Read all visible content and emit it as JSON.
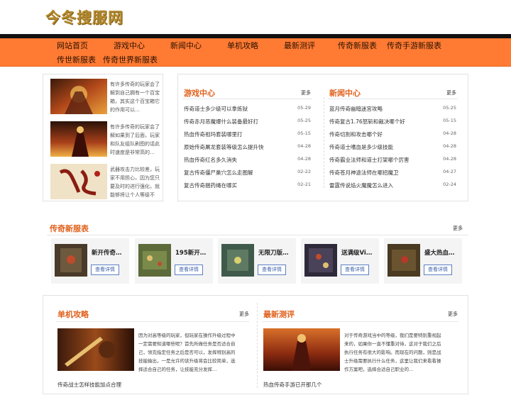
{
  "site": {
    "logo": "今冬搜服网"
  },
  "nav": {
    "items": [
      "网站首页",
      "游戏中心",
      "新闻中心",
      "单机攻略",
      "最新测评",
      "传奇新服表",
      "传奇手游新服表",
      "传世新服表",
      "传奇世界新服表"
    ]
  },
  "featured": [
    {
      "text": "有许多传奇的玩家会了解到自己拥有一个百宝箱，其实这个百宝箱它的作用可以…"
    },
    {
      "text": "有许多传奇的玩家会了解如果到了后面，玩家和队友组队刷图的话此时速度是非常高的…"
    },
    {
      "text": "武器攻击力比较差，玩家不用担心，因为您只要及时的进行强化，就能够将让个人等级不同…"
    }
  ],
  "game_center": {
    "title": "游戏中心",
    "more": "更多",
    "items": [
      {
        "title": "传奇道士多少级可以拿炼狱",
        "date": "05-29"
      },
      {
        "title": "传奇赤月恶魔爆什么装备最好打",
        "date": "05-25"
      },
      {
        "title": "热血传奇祖玛套装哪里打",
        "date": "05-15"
      },
      {
        "title": "原始传奇屠龙套装等级怎么提升快",
        "date": "04-28"
      },
      {
        "title": "热血传奇红名多久消失",
        "date": "04-28"
      },
      {
        "title": "复古传奇僵尸巢穴怎么走图解",
        "date": "02-22"
      },
      {
        "title": "复古传奇捆药绳在哪买",
        "date": "02-21"
      }
    ]
  },
  "news_center": {
    "title": "新闻中心",
    "more": "更多",
    "items": [
      {
        "title": "蓝月传奇幽暗迷宫攻略",
        "date": "05-25"
      },
      {
        "title": "传奇复古1.76怒斩和裁决哪个好",
        "date": "05-15"
      },
      {
        "title": "传奇切割和攻击哪个好",
        "date": "04-28"
      },
      {
        "title": "传奇道士嗜血是多少级技能",
        "date": "04-28"
      },
      {
        "title": "传奇霸业法师和道士打架哪个厉害",
        "date": "04-28"
      },
      {
        "title": "传奇苍月神途法师在哪招魔卫",
        "date": "04-27"
      },
      {
        "title": "雷霆传说焰火魔魔怎么进入",
        "date": "02-24"
      }
    ]
  },
  "new_servers": {
    "title": "传奇新服表",
    "more": "更多",
    "button": "查看详情",
    "items": [
      {
        "name": "新开传奇…"
      },
      {
        "name": "195新开…"
      },
      {
        "name": "无限刀版…"
      },
      {
        "name": "送满级Vi…"
      },
      {
        "name": "盛大热血…"
      }
    ]
  },
  "guides": {
    "title": "单机攻略",
    "more": "更多",
    "text": "因为对高等级的玩家，但玩家在操作升级过程中一定需要知道哪些呢？首先所做任务是否适合自己，领完指定任务之后是否可以，发挥特别高的技能输出，一是允许的该升级将会比较简单，选择适合自己的任务，让技能充分发挥…",
    "item": "传奇战士怎样技能加点合理"
  },
  "reviews": {
    "title": "最新测评",
    "more": "更多",
    "text": "对于传奇游戏当中的等级，我们是要特别重视起来的，如果你一直不懂重对待，这对于我们之后执行任务有很大的影响。而现在的问题，则是战士升级需要执行什么任务，这里让我们来看看操作方案吧，选择合适自己职业的…",
    "item": "热血传奇手游已开那几个"
  }
}
